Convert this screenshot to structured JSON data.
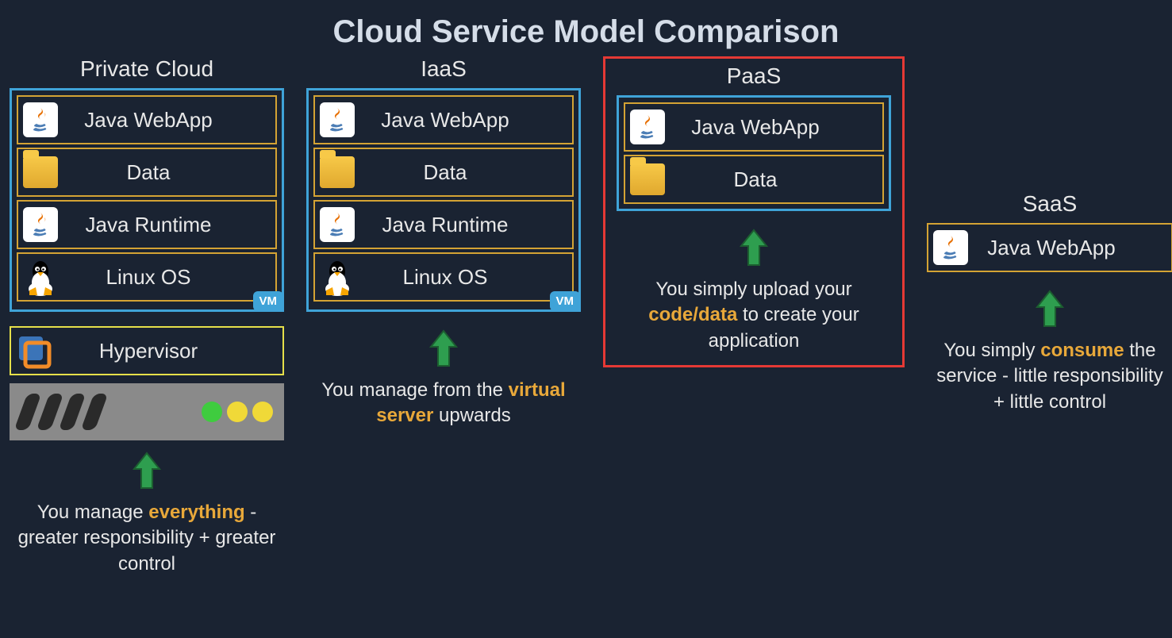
{
  "title": "Cloud Service Model Comparison",
  "columns": {
    "private": {
      "title": "Private Cloud",
      "layers": [
        "Java WebApp",
        "Data",
        "Java Runtime",
        "Linux OS"
      ],
      "vm_badge": "VM",
      "hypervisor": "Hypervisor",
      "caption_pre": "You manage ",
      "caption_hl": "everything",
      "caption_post": " - greater responsibility + greater control"
    },
    "iaas": {
      "title": "IaaS",
      "layers": [
        "Java WebApp",
        "Data",
        "Java Runtime",
        "Linux OS"
      ],
      "vm_badge": "VM",
      "caption_pre": "You manage from the ",
      "caption_hl": "virtual server",
      "caption_post": " upwards"
    },
    "paas": {
      "title": "PaaS",
      "layers": [
        "Java WebApp",
        "Data"
      ],
      "caption_pre": "You simply upload your ",
      "caption_hl": "code/data",
      "caption_post": " to create your application"
    },
    "saas": {
      "title": "SaaS",
      "layers": [
        "Java WebApp"
      ],
      "caption_pre": "You simply ",
      "caption_hl": "consume",
      "caption_post": " the service - little responsibility + little control"
    }
  }
}
